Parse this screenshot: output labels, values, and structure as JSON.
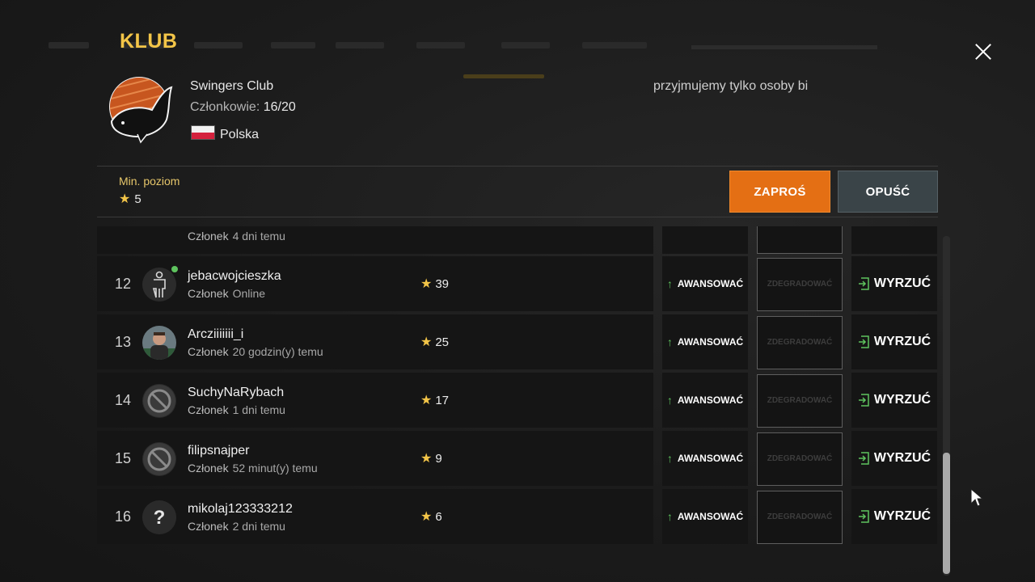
{
  "modal": {
    "title": "KLUB",
    "close_icon": "close-icon"
  },
  "club": {
    "name": "Swingers Club",
    "members_label": "Członkowie:",
    "members_value": "16/20",
    "country": "Polska",
    "flag_icon": "poland-flag-icon",
    "description": "przyjmujemy tylko osoby bi",
    "min_level_label": "Min. poziom",
    "min_level_value": "5"
  },
  "actions": {
    "invite_label": "ZAPROŚ",
    "leave_label": "OPUŚĆ"
  },
  "colors": {
    "accent_yellow": "#f3c548",
    "invite_orange": "#e46f14",
    "leave_slate": "#3a4448",
    "online_green": "#5ec35e"
  },
  "members": {
    "partial": {
      "role": "Członek",
      "last_seen": "4 dni temu"
    },
    "rows": [
      {
        "rank": "12",
        "nick": "jebacwojcieszka",
        "role": "Członek",
        "last_seen": "Online",
        "level": "39",
        "avatar": "person-silhouette-icon",
        "online": true
      },
      {
        "rank": "13",
        "nick": "Arcziiiiiii_i",
        "role": "Członek",
        "last_seen": "20 godzin(y) temu",
        "level": "25",
        "avatar": "photo-avatar",
        "online": false
      },
      {
        "rank": "14",
        "nick": "SuchyNaRybach",
        "role": "Członek",
        "last_seen": "1 dni temu",
        "level": "17",
        "avatar": "blocked-icon",
        "online": false
      },
      {
        "rank": "15",
        "nick": "filipsnajper",
        "role": "Członek",
        "last_seen": "52 minut(y) temu",
        "level": "9",
        "avatar": "blocked-icon",
        "online": false
      },
      {
        "rank": "16",
        "nick": "mikolaj123333212",
        "role": "Członek",
        "last_seen": "2 dni temu",
        "level": "6",
        "avatar": "question-mark-icon",
        "online": false
      }
    ],
    "promote_label": "AWANSOWAĆ",
    "demote_label": "ZDEGRADOWAĆ",
    "kick_label": "WYRZUĆ"
  }
}
